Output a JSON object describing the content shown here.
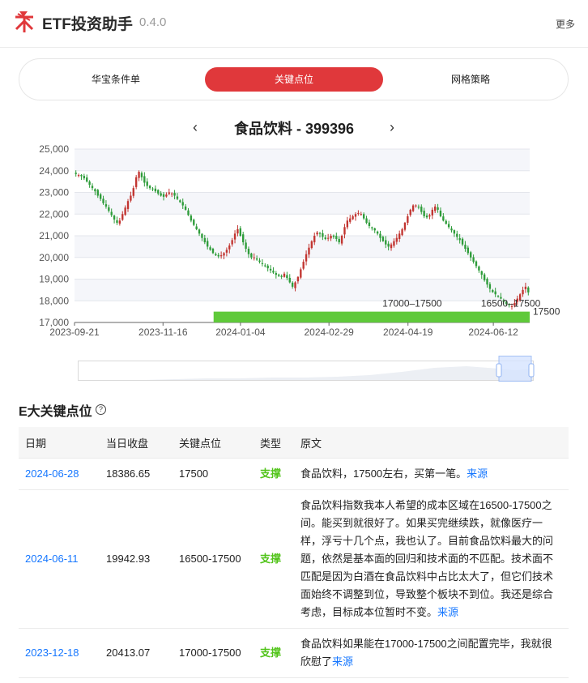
{
  "header": {
    "title": "ETF投资助手",
    "version": "0.4.0",
    "more_label": "更多"
  },
  "tabs": [
    {
      "label": "华宝条件单",
      "active": false
    },
    {
      "label": "关键点位",
      "active": true
    },
    {
      "label": "网格策略",
      "active": false
    }
  ],
  "chart_header": {
    "prev_icon": "‹",
    "title": "食品饮料 - 399396",
    "next_icon": "›"
  },
  "chart_data": {
    "type": "candlestick",
    "y_ticks": [
      "25,000",
      "24,000",
      "23,000",
      "22,000",
      "21,000",
      "20,000",
      "19,000",
      "18,000",
      "17,000"
    ],
    "ylim": [
      17000,
      25000
    ],
    "x_ticks": [
      "2023-09-21",
      "2023-11-16",
      "2024-01-04",
      "2024-02-29",
      "2024-04-19",
      "2024-06-12"
    ],
    "x_range": [
      "2023-09-21",
      "2024-07-05"
    ],
    "bands": [
      {
        "label": "17000–17500",
        "low": 17000,
        "high": 17500,
        "start": "2023-12-18",
        "end": "2024-07-05"
      },
      {
        "label": "16500–17500",
        "low": 16500,
        "high": 17500,
        "start": "2024-06-11",
        "end": "2024-07-05"
      }
    ],
    "line_label": "17500",
    "series": [
      {
        "values": [
          23850,
          23800,
          23750,
          23650,
          23500,
          23350,
          23200,
          23050,
          22850,
          22700,
          22500,
          22350,
          22150,
          21950,
          21750,
          21600,
          21700,
          22000,
          22300,
          22600,
          22850,
          23200,
          23700,
          23950,
          23700,
          23450,
          23300,
          23200,
          23150,
          23050,
          22950,
          22850,
          22800,
          22900,
          23000,
          22950,
          22850,
          22700,
          22550,
          22400,
          22200,
          21950,
          21700,
          21500,
          21300,
          21100,
          20900,
          20700,
          20500,
          20350,
          20200,
          20100,
          20050,
          20100,
          20200,
          20350,
          20550,
          20800,
          21100,
          21300,
          21000,
          20700,
          20400,
          20150,
          20000,
          20000,
          19900,
          19800,
          19700,
          19600,
          19500,
          19400,
          19300,
          19200,
          19150,
          19100,
          19250,
          19050,
          18850,
          18650,
          18850,
          19100,
          19450,
          19800,
          20150,
          20450,
          20750,
          21000,
          21150,
          21100,
          20950,
          20850,
          20900,
          21000,
          20950,
          20850,
          20700,
          21000,
          21400,
          21700,
          21800,
          21900,
          22000,
          22050,
          22000,
          21800,
          21600,
          21450,
          21350,
          21250,
          21100,
          20900,
          20750,
          20600,
          20500,
          20600,
          20750,
          20900,
          21100,
          21300,
          21600,
          21900,
          22200,
          22400,
          22400,
          22300,
          22100,
          21900,
          21850,
          21950,
          22200,
          22350,
          22200,
          21900,
          21700,
          21550,
          21400,
          21250,
          21100,
          20950,
          20800,
          20600,
          20400,
          20200,
          20000,
          19800,
          19600,
          19400,
          19200,
          18950,
          18750,
          18550,
          18400,
          18300,
          18200,
          18100,
          17950,
          17850,
          17800,
          17750,
          17900,
          18100,
          18300,
          18500,
          18650,
          18386.65
        ]
      }
    ]
  },
  "table": {
    "title": "E大关键点位",
    "help_icon": "question-circle-icon",
    "headers": [
      "日期",
      "当日收盘",
      "关键点位",
      "类型",
      "原文"
    ],
    "source_label": "来源",
    "rows": [
      {
        "date": "2024-06-28",
        "close": "18386.65",
        "level": "17500",
        "type": "支撑",
        "text": "食品饮料，17500左右，买第一笔。"
      },
      {
        "date": "2024-06-11",
        "close": "19942.93",
        "level": "16500-17500",
        "type": "支撑",
        "text": "食品饮料指数我本人希望的成本区域在16500-17500之间。能买到就很好了。如果买完继续跌，就像医疗一样，浮亏十几个点，我也认了。目前食品饮料最大的问题，依然是基本面的回归和技术面的不匹配。技术面不匹配是因为白酒在食品饮料中占比太大了，但它们技术面始终不调整到位，导致整个板块不到位。我还是综合考虑，目标成本位暂时不变。"
      },
      {
        "date": "2023-12-18",
        "close": "20413.07",
        "level": "17000-17500",
        "type": "支撑",
        "text": "食品饮料如果能在17000-17500之间配置完毕，我就很欣慰了"
      }
    ]
  },
  "colors": {
    "accent": "#e0383b",
    "up": "#c23531",
    "down": "#2e9c3a",
    "band": "#5fc93a",
    "link": "#1677ff",
    "support": "#52c41a"
  }
}
